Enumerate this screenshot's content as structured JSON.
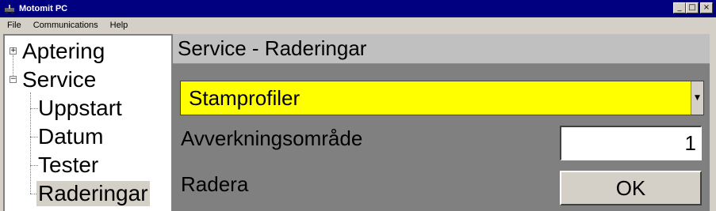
{
  "window": {
    "title": "Motomit PC",
    "minimize_glyph": "_",
    "maximize_glyph": "□",
    "close_glyph": "×"
  },
  "menu": {
    "file": "File",
    "communications": "Communications",
    "help": "Help"
  },
  "tree": {
    "aptering": "Aptering",
    "service": "Service",
    "children": {
      "uppstart": "Uppstart",
      "datum": "Datum",
      "tester": "Tester",
      "raderingar": "Raderingar"
    },
    "expand_glyph": "+",
    "collapse_glyph": "−",
    "selected_item": "Raderingar"
  },
  "panel": {
    "header": "Service - Raderingar",
    "dropdown_value": "Stamprofiler",
    "dropdown_color": "#ffff00",
    "area_label": "Avverkningsområde",
    "area_value": "1",
    "delete_label": "Radera",
    "ok_label": "OK"
  }
}
